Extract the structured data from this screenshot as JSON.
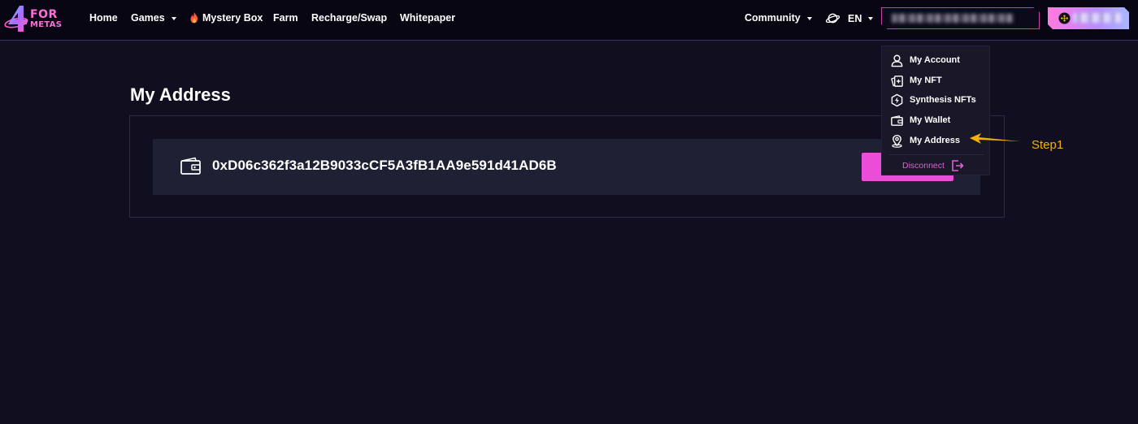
{
  "logo": {
    "line1": "FOR",
    "line2": "METAS"
  },
  "nav": {
    "home": "Home",
    "games": "Games",
    "mystery_box": "Mystery Box",
    "farm": "Farm",
    "recharge_swap": "Recharge/Swap",
    "whitepaper": "Whitepaper",
    "community": "Community",
    "language": "EN"
  },
  "page": {
    "title": "My Address",
    "address": "0xD06c362f3a12B9033cCF5A3fB1AA9e591d41AD6B"
  },
  "dropdown": {
    "items": [
      {
        "label": "My Account",
        "icon": "user-icon"
      },
      {
        "label": "My NFT",
        "icon": "nft-cards-icon"
      },
      {
        "label": "Synthesis NFTs",
        "icon": "synthesis-bolt-icon"
      },
      {
        "label": "My Wallet",
        "icon": "wallet-icon"
      },
      {
        "label": "My Address",
        "icon": "location-pin-icon"
      }
    ],
    "disconnect": "Disconnect"
  },
  "annotation": {
    "step": "Step1"
  },
  "colors": {
    "background": "#110e20",
    "topbar": "#080612",
    "accent_pink": "#ec4dd8",
    "annotation": "#f5b10a"
  }
}
